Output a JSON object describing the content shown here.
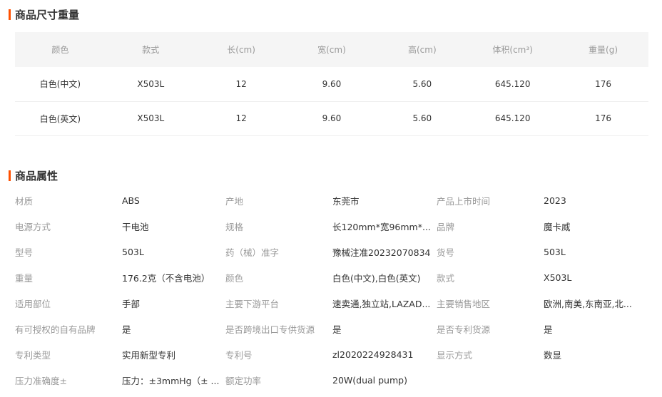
{
  "size_section": {
    "title": "商品尺寸重量",
    "headers": [
      "颜色",
      "款式",
      "长(cm)",
      "宽(cm)",
      "高(cm)",
      "体积(cm³)",
      "重量(g)"
    ],
    "rows": [
      [
        "白色(中文)",
        "X503L",
        "12",
        "9.60",
        "5.60",
        "645.120",
        "176"
      ],
      [
        "白色(英文)",
        "X503L",
        "12",
        "9.60",
        "5.60",
        "645.120",
        "176"
      ]
    ]
  },
  "attr_section": {
    "title": "商品属性",
    "rows": [
      [
        [
          "材质",
          "ABS"
        ],
        [
          "产地",
          "东莞市"
        ],
        [
          "产品上市时间",
          "2023"
        ]
      ],
      [
        [
          "电源方式",
          "干电池"
        ],
        [
          "规格",
          "长120mm*宽96mm*..."
        ],
        [
          "品牌",
          "魔卡威"
        ]
      ],
      [
        [
          "型号",
          "503L"
        ],
        [
          "药（械）准字",
          "豫械注准20232070834"
        ],
        [
          "货号",
          "503L"
        ]
      ],
      [
        [
          "重量",
          "176.2克（不含电池）"
        ],
        [
          "颜色",
          "白色(中文),白色(英文)"
        ],
        [
          "款式",
          "X503L"
        ]
      ],
      [
        [
          "适用部位",
          "手部"
        ],
        [
          "主要下游平台",
          "速卖通,独立站,LAZAD..."
        ],
        [
          "主要销售地区",
          "欧洲,南美,东南亚,北..."
        ]
      ],
      [
        [
          "有可授权的自有品牌",
          "是"
        ],
        [
          "是否跨境出口专供货源",
          "是"
        ],
        [
          "是否专利货源",
          "是"
        ]
      ],
      [
        [
          "专利类型",
          "实用新型专利"
        ],
        [
          "专利号",
          "zl2020224928431"
        ],
        [
          "显示方式",
          "数显"
        ]
      ],
      [
        [
          "压力准确度±",
          "压力：±3mmHg（± ..."
        ],
        [
          "额定功率",
          "20W(dual pump)"
        ],
        [
          "",
          ""
        ]
      ]
    ]
  }
}
